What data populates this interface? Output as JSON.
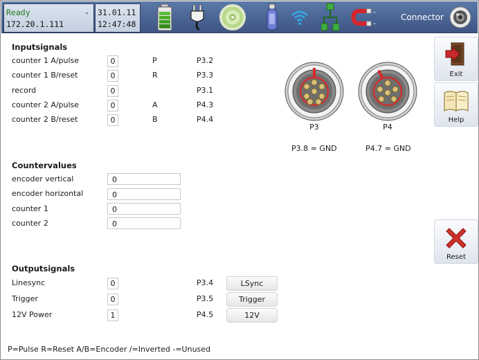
{
  "status": {
    "state": "Ready",
    "state_suffix": "-",
    "ip": "172.20.1.111",
    "date": "31.01.11",
    "time": "12:47:48",
    "connector_label": "Connector"
  },
  "icons": [
    "battery-icon",
    "power-plug-icon",
    "disc-icon",
    "usb-stick-icon",
    "wifi-icon",
    "network-icon",
    "magnet-icon",
    "camera-connector-icon"
  ],
  "inputs": {
    "title": "Inputsignals",
    "rows": [
      {
        "label": "counter 1 A/pulse",
        "value": "0",
        "code": "P",
        "pin": "P3.2"
      },
      {
        "label": "counter 1 B/reset",
        "value": "0",
        "code": "R",
        "pin": "P3.3"
      },
      {
        "label": "record",
        "value": "0",
        "code": "",
        "pin": "P3.1"
      },
      {
        "label": "counter 2 A/pulse",
        "value": "0",
        "code": "A",
        "pin": "P4.3"
      },
      {
        "label": "counter 2 B/reset",
        "value": "0",
        "code": "B",
        "pin": "P4.4"
      }
    ]
  },
  "connectors": {
    "p3": {
      "label": "P3",
      "gnd": "P3.8 = GND"
    },
    "p4": {
      "label": "P4",
      "gnd": "P4.7 = GND"
    }
  },
  "counters": {
    "title": "Countervalues",
    "rows": [
      {
        "label": "encoder vertical",
        "value": "0"
      },
      {
        "label": "encoder horizontal",
        "value": "0"
      },
      {
        "label": "counter 1",
        "value": "0"
      },
      {
        "label": "counter 2",
        "value": "0"
      }
    ]
  },
  "outputs": {
    "title": "Outputsignals",
    "rows": [
      {
        "label": "Linesync",
        "value": "0",
        "pin": "P3.4",
        "button": "LSync"
      },
      {
        "label": "Trigger",
        "value": "0",
        "pin": "P3.5",
        "button": "Trigger"
      },
      {
        "label": "12V Power",
        "value": "1",
        "pin": "P4.5",
        "button": "12V"
      }
    ]
  },
  "side": {
    "exit": "Exit",
    "help": "Help",
    "reset": "Reset"
  },
  "legend": "P=Pulse R=Reset A/B=Encoder /=Inverted -=Unused",
  "colors": {
    "topbar": "#4a6493",
    "ready": "#1c7a1c",
    "reset_x": "#d0302a",
    "exit_red": "#c8282a"
  }
}
